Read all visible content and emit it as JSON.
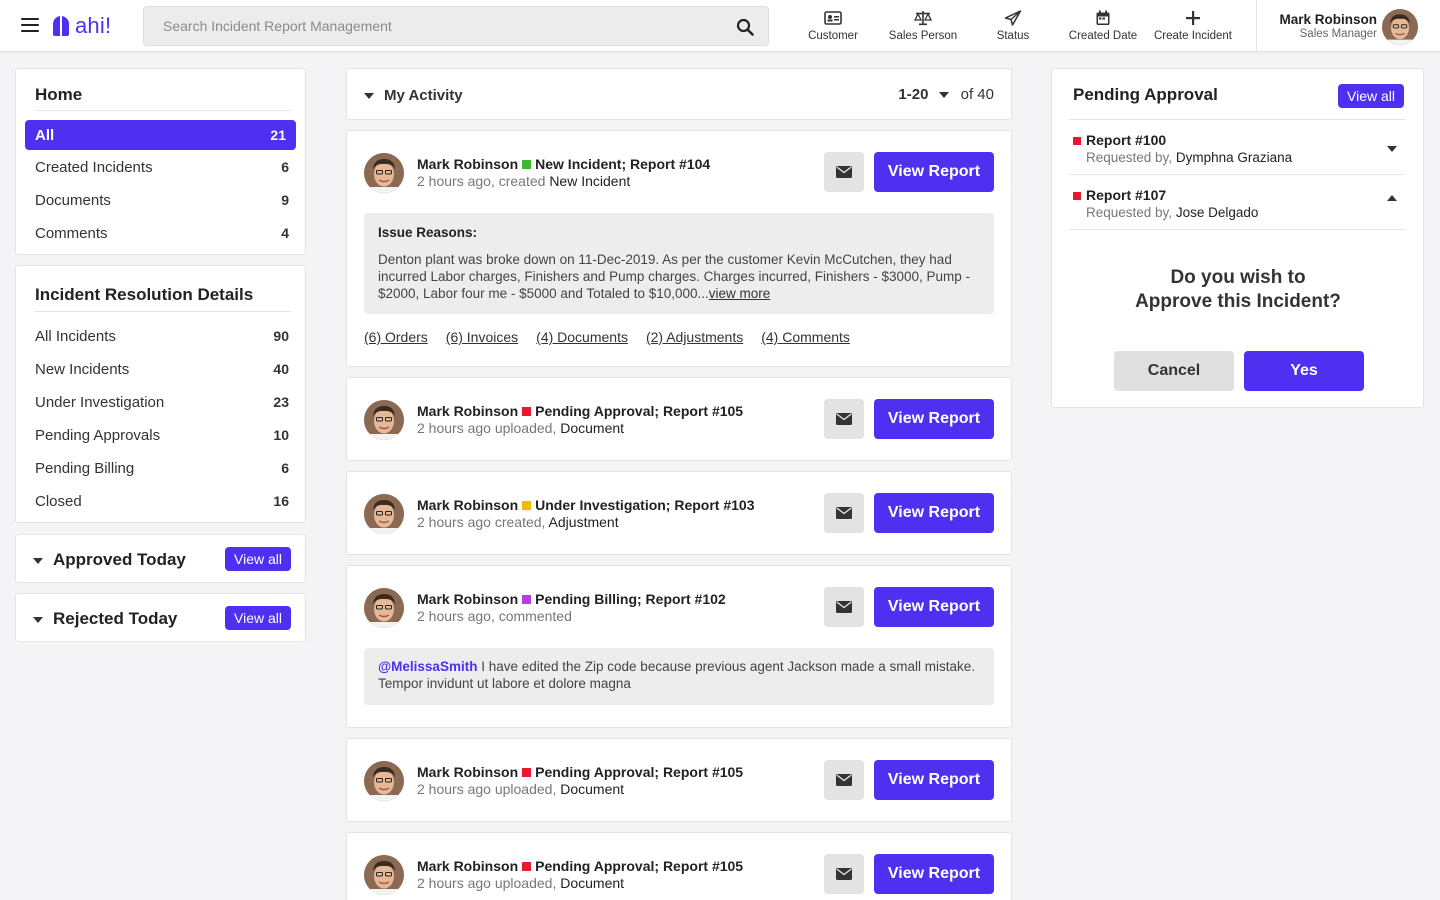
{
  "app": {
    "logo_text": "ahi!"
  },
  "search": {
    "placeholder": "Search Incident Report Management"
  },
  "nav": [
    {
      "label": "Customer",
      "icon": "id-card-icon"
    },
    {
      "label": "Sales Person",
      "icon": "scale-icon"
    },
    {
      "label": "Status",
      "icon": "paper-plane-icon"
    },
    {
      "label": "Created Date",
      "icon": "calendar-icon"
    },
    {
      "label": "Create Incident",
      "icon": "plus-icon"
    }
  ],
  "user": {
    "name": "Mark Robinson",
    "role": "Sales Manager"
  },
  "home": {
    "title": "Home",
    "items": [
      {
        "label": "All",
        "count": "21"
      },
      {
        "label": "Created Incidents",
        "count": "6"
      },
      {
        "label": "Documents",
        "count": "9"
      },
      {
        "label": "Comments",
        "count": "4"
      }
    ]
  },
  "resolution": {
    "title": "Incident Resolution Details",
    "items": [
      {
        "label": "All Incidents",
        "count": "90"
      },
      {
        "label": "New Incidents",
        "count": "40"
      },
      {
        "label": "Under Investigation",
        "count": "23"
      },
      {
        "label": "Pending Approvals",
        "count": "10"
      },
      {
        "label": "Pending Billing",
        "count": "6"
      },
      {
        "label": "Closed",
        "count": "16"
      }
    ]
  },
  "approved_today": {
    "title": "Approved Today",
    "button": "View all"
  },
  "rejected_today": {
    "title": "Rejected Today",
    "button": "View all"
  },
  "activity": {
    "title": "My Activity",
    "range": "1-20",
    "total": "of 40",
    "view_report_label": "View Report",
    "feed": [
      {
        "author": "Mark Robinson",
        "status": "New Incident; Report #104",
        "status_color": "#3cb72f",
        "time": "2 hours ago, created",
        "object": "New Incident",
        "issue_title": "Issue Reasons:",
        "issue_text": "Denton plant was broke down on 11-Dec-2019. As per the customer Kevin McCutchen, they had incurred Labor charges, Finishers and Pump charges. Charges incurred, Finishers - $3000, Pump - $2000, Labor four me - $5000 and Totaled to $10,000...",
        "view_more": "view more",
        "links": [
          "(6) Orders",
          "(6) Invoices",
          "(4) Documents",
          "(2) Adjustments",
          "(4) Comments"
        ]
      },
      {
        "author": "Mark Robinson",
        "status": "Pending Approval; Report #105",
        "status_color": "#e8192c",
        "time": "2 hours ago uploaded,",
        "object": "Document"
      },
      {
        "author": "Mark Robinson",
        "status": "Under Investigation; Report #103",
        "status_color": "#f5b800",
        "time": "2 hours ago created,",
        "object": "Adjustment"
      },
      {
        "author": "Mark Robinson",
        "status": "Pending Billing; Report #102",
        "status_color": "#b43ee0",
        "time": "2 hours ago, commented",
        "object": "",
        "mention": "@MelissaSmith",
        "comment": " I have edited the Zip code because previous agent Jackson made a small mistake. Tempor invidunt ut labore et dolore magna"
      },
      {
        "author": "Mark Robinson",
        "status": "Pending Approval; Report #105",
        "status_color": "#e8192c",
        "time": "2 hours ago uploaded,",
        "object": "Document"
      },
      {
        "author": "Mark Robinson",
        "status": "Pending Approval; Report #105",
        "status_color": "#e8192c",
        "time": "2 hours ago uploaded,",
        "object": "Document"
      }
    ]
  },
  "pending": {
    "title": "Pending Approval",
    "button": "View all",
    "requested_by_label": "Requested by,",
    "reports": [
      {
        "title": "Report #100",
        "requester": "Dymphna Graziana"
      },
      {
        "title": "Report #107",
        "requester": "Jose Delgado"
      }
    ],
    "question_line1": "Do you wish to",
    "question_line2": "Approve this Incident?",
    "cancel": "Cancel",
    "yes": "Yes"
  },
  "colors": {
    "accent": "#4f2ff0",
    "red": "#e8192c",
    "green": "#3cb72f",
    "yellow": "#f5b800",
    "purple": "#b43ee0"
  }
}
